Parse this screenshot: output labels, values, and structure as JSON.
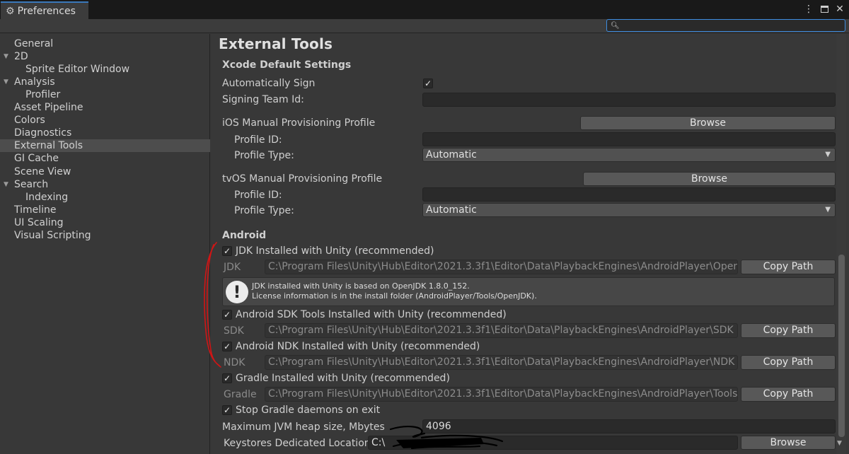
{
  "window": {
    "tab_title": "Preferences",
    "controls": [
      "more-icon",
      "maximize-icon",
      "close-icon"
    ]
  },
  "search": {
    "placeholder": "",
    "value": ""
  },
  "sidebar": {
    "items": [
      {
        "label": "General",
        "indent": 0,
        "expanded": null,
        "selected": false
      },
      {
        "label": "2D",
        "indent": 0,
        "expanded": true,
        "selected": false
      },
      {
        "label": "Sprite Editor Window",
        "indent": 1,
        "expanded": null,
        "selected": false
      },
      {
        "label": "Analysis",
        "indent": 0,
        "expanded": true,
        "selected": false
      },
      {
        "label": "Profiler",
        "indent": 1,
        "expanded": null,
        "selected": false
      },
      {
        "label": "Asset Pipeline",
        "indent": 0,
        "expanded": null,
        "selected": false
      },
      {
        "label": "Colors",
        "indent": 0,
        "expanded": null,
        "selected": false
      },
      {
        "label": "Diagnostics",
        "indent": 0,
        "expanded": null,
        "selected": false
      },
      {
        "label": "External Tools",
        "indent": 0,
        "expanded": null,
        "selected": true
      },
      {
        "label": "GI Cache",
        "indent": 0,
        "expanded": null,
        "selected": false
      },
      {
        "label": "Scene View",
        "indent": 0,
        "expanded": null,
        "selected": false
      },
      {
        "label": "Search",
        "indent": 0,
        "expanded": true,
        "selected": false
      },
      {
        "label": "Indexing",
        "indent": 1,
        "expanded": null,
        "selected": false
      },
      {
        "label": "Timeline",
        "indent": 0,
        "expanded": null,
        "selected": false
      },
      {
        "label": "UI Scaling",
        "indent": 0,
        "expanded": null,
        "selected": false
      },
      {
        "label": "Visual Scripting",
        "indent": 0,
        "expanded": null,
        "selected": false
      }
    ]
  },
  "main": {
    "title": "External Tools",
    "xcode": {
      "header": "Xcode Default Settings",
      "auto_sign_label": "Automatically Sign",
      "auto_sign_checked": true,
      "team_id_label": "Signing Team Id:",
      "team_id_value": ""
    },
    "ios": {
      "header": "iOS Manual Provisioning Profile",
      "browse_label": "Browse",
      "profile_id_label": "Profile ID:",
      "profile_id_value": "",
      "profile_type_label": "Profile Type:",
      "profile_type_value": "Automatic"
    },
    "tvos": {
      "header": "tvOS Manual Provisioning Profile",
      "browse_label": "Browse",
      "profile_id_label": "Profile ID:",
      "profile_id_value": "",
      "profile_type_label": "Profile Type:",
      "profile_type_value": "Automatic"
    },
    "android": {
      "header": "Android",
      "jdk_check_label": "JDK Installed with Unity (recommended)",
      "jdk_checked": true,
      "jdk_label": "JDK",
      "jdk_path": "C:\\Program Files\\Unity\\Hub\\Editor\\2021.3.3f1\\Editor\\Data\\PlaybackEngines\\AndroidPlayer\\OpenJDK",
      "copy_path_label": "Copy Path",
      "info_line1": "JDK installed with Unity is based on OpenJDK 1.8.0_152.",
      "info_line2": "License information is in the install folder (AndroidPlayer/Tools/OpenJDK).",
      "sdk_check_label": "Android SDK Tools Installed with Unity (recommended)",
      "sdk_checked": true,
      "sdk_label": "SDK",
      "sdk_path": "C:\\Program Files\\Unity\\Hub\\Editor\\2021.3.3f1\\Editor\\Data\\PlaybackEngines\\AndroidPlayer\\SDK",
      "ndk_check_label": "Android NDK Installed with Unity (recommended)",
      "ndk_checked": true,
      "ndk_label": "NDK",
      "ndk_path": "C:\\Program Files\\Unity\\Hub\\Editor\\2021.3.3f1\\Editor\\Data\\PlaybackEngines\\AndroidPlayer\\NDK",
      "gradle_check_label": "Gradle Installed with Unity (recommended)",
      "gradle_checked": true,
      "gradle_label": "Gradle",
      "gradle_path": "C:\\Program Files\\Unity\\Hub\\Editor\\2021.3.3f1\\Editor\\Data\\PlaybackEngines\\AndroidPlayer\\Tools\\gradle",
      "stop_gradle_label": "Stop Gradle daemons on exit",
      "stop_gradle_checked": true,
      "jvm_heap_label": "Maximum JVM heap size, Mbytes",
      "jvm_heap_value": "4096",
      "keystore_label": "Keystores Dedicated Location",
      "keystore_value": "C:\\",
      "keystore_browse_label": "Browse"
    }
  },
  "colors": {
    "accent": "#3d8ce0",
    "annotation": "#d01515",
    "redaction": "#000000"
  }
}
